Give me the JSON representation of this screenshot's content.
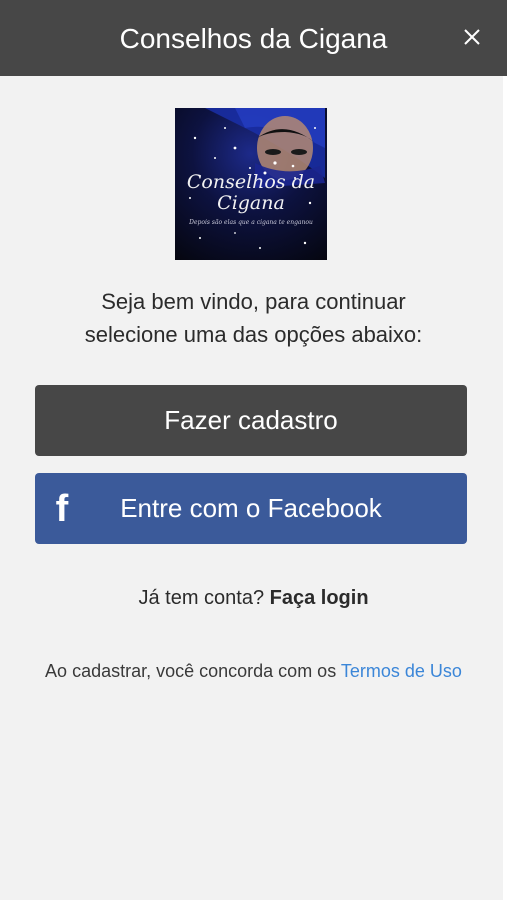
{
  "header": {
    "title": "Conselhos da Cigana",
    "close_icon": "close-icon"
  },
  "logo": {
    "title_line1": "Conselhos da",
    "title_line2": "Cigana",
    "subtitle": "Depois são elas que a cigana te enganou"
  },
  "welcome": {
    "line1": "Seja bem vindo, para continuar",
    "line2": "selecione uma das opções abaixo:"
  },
  "buttons": {
    "register_label": "Fazer cadastro",
    "facebook_label": "Entre com o Facebook",
    "facebook_icon": "facebook-icon",
    "facebook_glyph": "f"
  },
  "login": {
    "prompt": "Já tem conta?",
    "link": "Faça login"
  },
  "terms": {
    "text": "Ao cadastrar, você concorda com os",
    "link": "Termos de Uso"
  },
  "colors": {
    "header_bg": "#474747",
    "register_bg": "#474747",
    "facebook_bg": "#3b5a9a",
    "link": "#3b86d8",
    "page_bg": "#f2f2f2"
  }
}
